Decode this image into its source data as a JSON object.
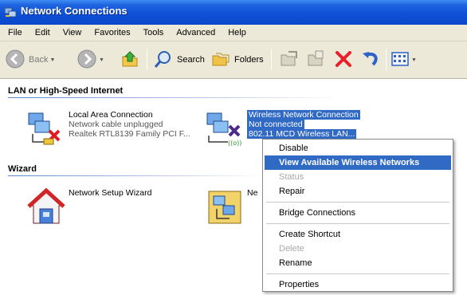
{
  "window": {
    "title": "Network Connections",
    "title_bar_color": "#0b47c8"
  },
  "menu": {
    "items": [
      "File",
      "Edit",
      "View",
      "Favorites",
      "Tools",
      "Advanced",
      "Help"
    ]
  },
  "toolbar": {
    "back_label": "Back",
    "search_label": "Search",
    "folders_label": "Folders",
    "icons": [
      "back-arrow-icon",
      "forward-arrow-icon",
      "up-folder-icon",
      "search-icon",
      "folders-icon",
      "move-to-icon",
      "copy-to-icon",
      "delete-icon",
      "undo-icon",
      "views-icon"
    ]
  },
  "groups": {
    "lan": {
      "header": "LAN or High-Speed Internet",
      "local": {
        "name": "Local Area Connection",
        "status": "Network cable unplugged",
        "device": "Realtek RTL8139 Family PCI F..."
      },
      "wireless": {
        "name": "Wireless Network Connection",
        "status": "Not connected",
        "device": "802.11 MCD Wireless LAN..."
      }
    },
    "wizard": {
      "header": "Wizard",
      "setup": {
        "name": "Network Setup Wizard"
      },
      "new": {
        "name": "Ne"
      }
    }
  },
  "context_menu": {
    "items": [
      {
        "label": "Disable",
        "state": "normal"
      },
      {
        "label": "View Available Wireless Networks",
        "state": "highlighted-bold"
      },
      {
        "label": "Status",
        "state": "disabled"
      },
      {
        "label": "Repair",
        "state": "normal"
      },
      {
        "label": "Bridge Connections",
        "state": "normal"
      },
      {
        "label": "Create Shortcut",
        "state": "normal"
      },
      {
        "label": "Delete",
        "state": "disabled"
      },
      {
        "label": "Rename",
        "state": "normal"
      },
      {
        "label": "Properties",
        "state": "normal"
      }
    ],
    "highlight_color": "#316ac5"
  }
}
